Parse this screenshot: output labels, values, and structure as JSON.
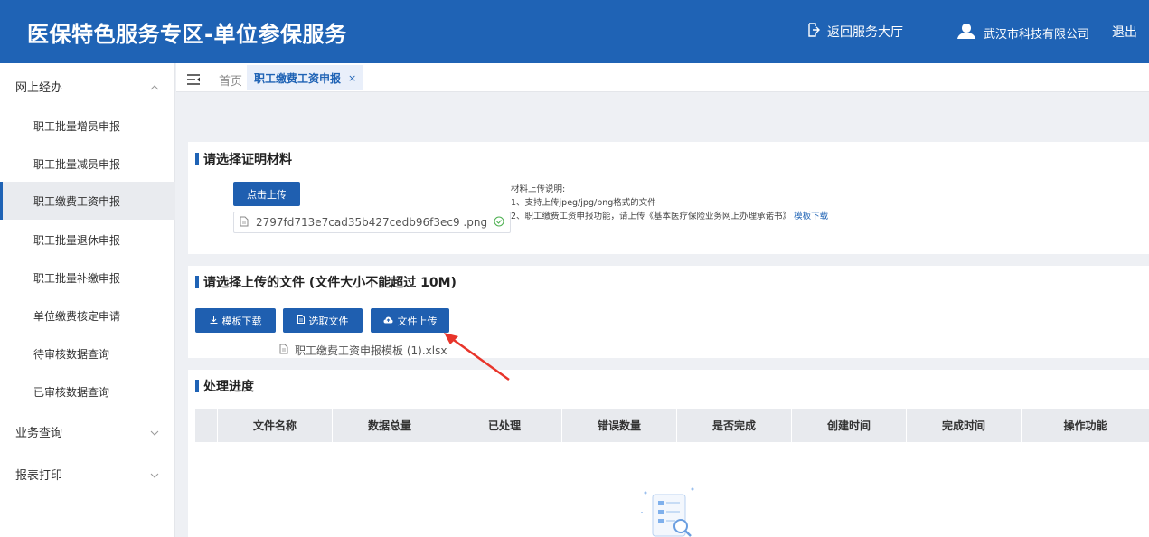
{
  "header": {
    "title": "医保特色服务专区-单位参保服务",
    "back_label": "返回服务大厅",
    "company": "武汉市科技有限公司",
    "logout": "退出"
  },
  "sidebar": {
    "group_online": "网上经办",
    "items": [
      {
        "label": "职工批量增员申报"
      },
      {
        "label": "职工批量减员申报"
      },
      {
        "label": "职工缴费工资申报"
      },
      {
        "label": "职工批量退休申报"
      },
      {
        "label": "职工批量补缴申报"
      },
      {
        "label": "单位缴费核定申请"
      },
      {
        "label": "待审核数据查询"
      },
      {
        "label": "已审核数据查询"
      }
    ],
    "group_query": "业务查询",
    "group_report": "报表打印"
  },
  "tabs": {
    "home": "首页",
    "active": "职工缴费工资申报",
    "close": "×"
  },
  "proof": {
    "title": "请选择证明材料",
    "upload_btn": "点击上传",
    "file_name": "2797fd713e7cad35b427cedb96f3ec9 .png",
    "note_title": "材料上传说明:",
    "note_1": "1、支持上传jpeg/jpg/png格式的文件",
    "note_2": "2、职工缴费工资申报功能，请上传《基本医疗保险业务网上办理承诺书》",
    "note_link": "模板下载"
  },
  "upload": {
    "title": "请选择上传的文件 (文件大小不能超过 10M)",
    "btn_template": "模板下载",
    "btn_choose": "选取文件",
    "btn_upload": "文件上传",
    "file_name": "职工缴费工资申报模板 (1).xlsx"
  },
  "progress": {
    "title": "处理进度",
    "columns": [
      "文件名称",
      "数据总量",
      "已处理",
      "错误数量",
      "是否完成",
      "创建时间",
      "完成时间",
      "操作功能"
    ]
  },
  "colors": {
    "brand": "#1f63b5",
    "annotation_arrow": "#e8352b"
  }
}
